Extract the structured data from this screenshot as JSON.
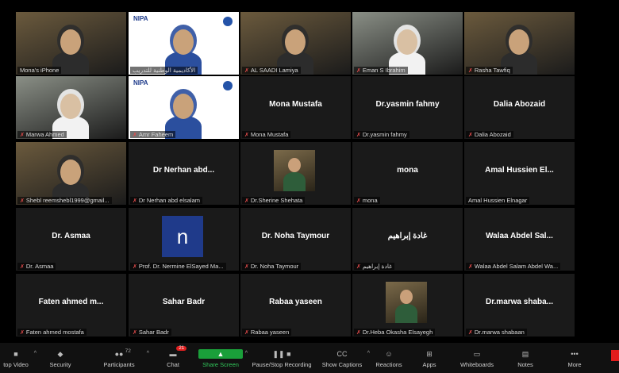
{
  "tiles": [
    {
      "label": "Mona's iPhone",
      "muted": false,
      "active": true,
      "kind": "video"
    },
    {
      "label": "الأكاديمية الوطنية للتدريب",
      "muted": false,
      "active": false,
      "kind": "video-logo",
      "brand": "NIPA"
    },
    {
      "label": "AL SAADI Lamiya",
      "muted": true,
      "active": false,
      "kind": "video"
    },
    {
      "label": "Eman S Ibrahim",
      "muted": true,
      "active": false,
      "kind": "video"
    },
    {
      "label": "Rasha Tawfiq",
      "muted": true,
      "active": false,
      "kind": "video"
    },
    {
      "label": "Marwa Ahmed",
      "muted": true,
      "active": false,
      "kind": "video"
    },
    {
      "label": "Amr Faheem",
      "muted": true,
      "active": false,
      "kind": "video-logo",
      "brand": "NIPA"
    },
    {
      "name": "Mona Mustafa",
      "label": "Mona Mustafa",
      "muted": true,
      "active": false,
      "kind": "name"
    },
    {
      "name": "Dr.yasmin fahmy",
      "label": "Dr.yasmin fahmy",
      "muted": true,
      "active": false,
      "kind": "name"
    },
    {
      "name": "Dalia Abozaid",
      "label": "Dalia Abozaid",
      "muted": true,
      "active": false,
      "kind": "name"
    },
    {
      "label": "Shebl reemshebl1999@gmail...",
      "muted": true,
      "active": false,
      "kind": "video"
    },
    {
      "name": "Dr Nerhan abd...",
      "label": "Dr Nerhan abd elsalam",
      "muted": true,
      "active": false,
      "kind": "name"
    },
    {
      "label": "Dr.Sherine Shehata",
      "muted": true,
      "active": false,
      "kind": "video-small"
    },
    {
      "name": "mona",
      "label": "mona",
      "muted": true,
      "active": false,
      "kind": "name"
    },
    {
      "name": "Amal Hussien El...",
      "label": "Amal Hussien Elnagar",
      "muted": false,
      "active": false,
      "kind": "name"
    },
    {
      "name": "Dr. Asmaa",
      "label": "Dr. Asmaa",
      "muted": true,
      "active": false,
      "kind": "name"
    },
    {
      "avatar": "n",
      "label": "Prof. Dr. Nermine ElSayed Ma...",
      "muted": true,
      "active": false,
      "kind": "avatar"
    },
    {
      "name": "Dr. Noha Taymour",
      "label": "Dr. Noha Taymour",
      "muted": true,
      "active": false,
      "kind": "name"
    },
    {
      "name": "غادة إبراهيم",
      "label": "غادة إبراهيم",
      "muted": true,
      "active": false,
      "kind": "name"
    },
    {
      "name": "Walaa Abdel Sal...",
      "label": "Walaa Abdel Salam Abdel Wa...",
      "muted": true,
      "active": false,
      "kind": "name"
    },
    {
      "name": "Faten ahmed m...",
      "label": "Faten ahmed mostafa",
      "muted": true,
      "active": false,
      "kind": "name"
    },
    {
      "name": "Sahar Badr",
      "label": "Sahar Badr",
      "muted": true,
      "active": false,
      "kind": "name"
    },
    {
      "name": "Rabaa yaseen",
      "label": "Rabaa yaseen",
      "muted": true,
      "active": false,
      "kind": "name"
    },
    {
      "label": "Dr.Heba Okasha Elsayegh",
      "muted": true,
      "active": false,
      "kind": "video-small"
    },
    {
      "name": "Dr.marwa shaba...",
      "label": "Dr.marwa shabaan",
      "muted": true,
      "active": false,
      "kind": "name"
    }
  ],
  "toolbar": {
    "items": [
      {
        "label": "top Video",
        "icon": "video-camera-icon",
        "caret": true
      },
      {
        "label": "Security",
        "icon": "shield-icon",
        "caret": false
      },
      {
        "label": "Participants",
        "icon": "participants-icon",
        "caret": true,
        "count": "72"
      },
      {
        "label": "Chat",
        "icon": "chat-icon",
        "caret": false,
        "badge": "21"
      },
      {
        "label": "Share Screen",
        "icon": "share-screen-icon",
        "caret": true
      },
      {
        "label": "Pause/Stop Recording",
        "icon": "pause-stop-icon",
        "caret": false
      },
      {
        "label": "Show Captions",
        "icon": "captions-icon",
        "caret": true
      },
      {
        "label": "Reactions",
        "icon": "reactions-icon",
        "caret": false
      },
      {
        "label": "Apps",
        "icon": "apps-icon",
        "caret": false
      },
      {
        "label": "Whiteboards",
        "icon": "whiteboard-icon",
        "caret": false
      },
      {
        "label": "Notes",
        "icon": "notes-icon",
        "caret": false
      },
      {
        "label": "More",
        "icon": "more-icon",
        "caret": false
      }
    ]
  },
  "colors": {
    "active_border": "#b7d63c",
    "muted_mic": "#e24b4b",
    "share_green": "#1a9f3a",
    "badge_red": "#e02020"
  }
}
